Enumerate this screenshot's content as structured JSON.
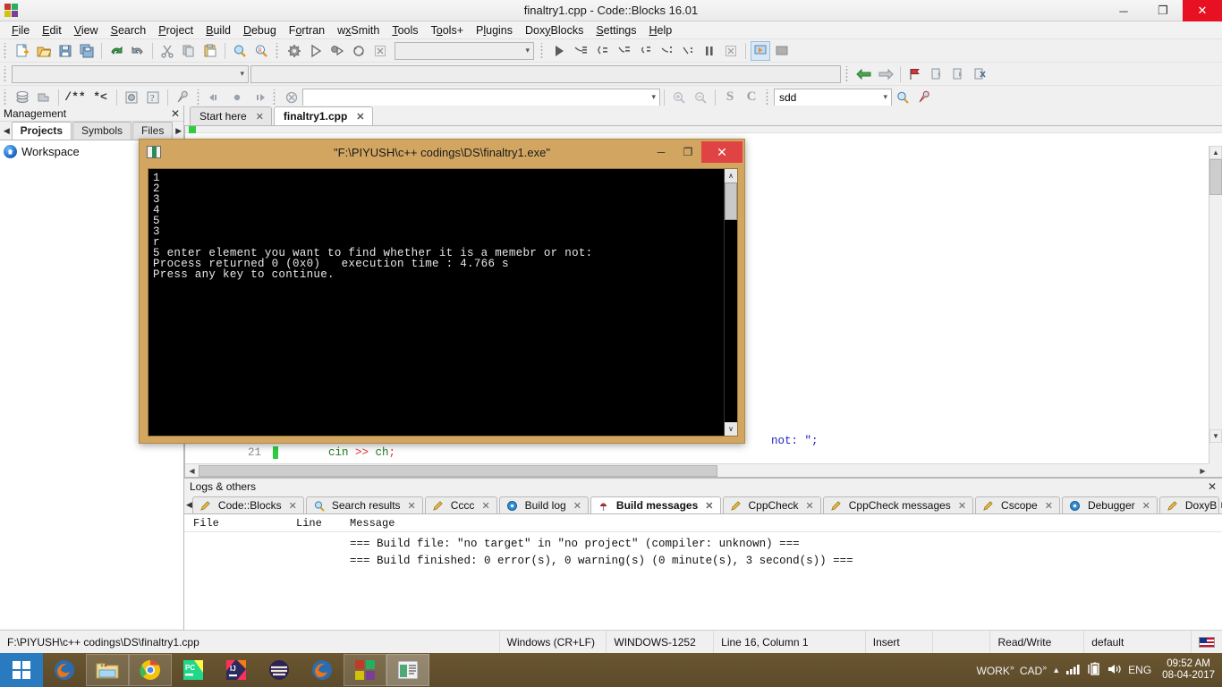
{
  "window": {
    "title": "finaltry1.cpp - Code::Blocks 16.01",
    "minimize": "─",
    "maximize": "❐",
    "close": "✕"
  },
  "menubar": {
    "items": [
      {
        "label": "File",
        "mnemonic": "F"
      },
      {
        "label": "Edit",
        "mnemonic": "E"
      },
      {
        "label": "View",
        "mnemonic": "V"
      },
      {
        "label": "Search",
        "mnemonic": "S"
      },
      {
        "label": "Project",
        "mnemonic": "P"
      },
      {
        "label": "Build",
        "mnemonic": "B"
      },
      {
        "label": "Debug",
        "mnemonic": "D"
      },
      {
        "label": "Fortran",
        "mnemonic": "o"
      },
      {
        "label": "wxSmith",
        "mnemonic": "x"
      },
      {
        "label": "Tools",
        "mnemonic": "T"
      },
      {
        "label": "Tools+",
        "mnemonic": "o"
      },
      {
        "label": "Plugins",
        "mnemonic": "l"
      },
      {
        "label": "DoxyBlocks",
        "mnemonic": "y"
      },
      {
        "label": "Settings",
        "mnemonic": "S"
      },
      {
        "label": "Help",
        "mnemonic": "H"
      }
    ]
  },
  "toolbars": {
    "build_target_value": "",
    "build_target_placeholder": "",
    "symbol_combo_value": "",
    "search_value": "sdd",
    "search_placeholder": ""
  },
  "management": {
    "title": "Management",
    "close_label": "✕",
    "prev_label": "◀",
    "next_label": "▶",
    "tabs": [
      {
        "label": "Projects",
        "active": true
      },
      {
        "label": "Symbols",
        "active": false
      },
      {
        "label": "Files",
        "active": false
      }
    ],
    "tree_root": "Workspace"
  },
  "editor": {
    "tabs": [
      {
        "label": "Start here",
        "active": false,
        "close": "✕"
      },
      {
        "label": "finaltry1.cpp",
        "active": true,
        "close": "✕"
      }
    ],
    "visible_code": [
      {
        "line_number": "21",
        "text": "cin >> ch;"
      }
    ],
    "visible_fragment": "not: \";"
  },
  "console": {
    "title": "\"F:\\PIYUSH\\c++ codings\\DS\\finaltry1.exe\"",
    "minimize": "─",
    "maximize": "❐",
    "close": "✕",
    "output": "1\n2\n3\n4\n5\n3\nr\n5 enter element you want to find whether it is a memebr or not:\nProcess returned 0 (0x0)   execution time : 4.766 s\nPress any key to continue.",
    "scroll_up": "∧",
    "scroll_down": "∨"
  },
  "logs": {
    "title": "Logs & others",
    "close_label": "✕",
    "prev_label": "◀",
    "next_label": "▶",
    "tabs": [
      {
        "label": "Code::Blocks",
        "active": false,
        "icon": "pencil-icon",
        "close": "✕"
      },
      {
        "label": "Search results",
        "active": false,
        "icon": "magnifier-icon",
        "close": "✕"
      },
      {
        "label": "Cccc",
        "active": false,
        "icon": "pencil-icon",
        "close": "✕"
      },
      {
        "label": "Build log",
        "active": false,
        "icon": "gear-blue-icon",
        "close": "✕"
      },
      {
        "label": "Build messages",
        "active": true,
        "icon": "pin-icon",
        "close": "✕"
      },
      {
        "label": "CppCheck",
        "active": false,
        "icon": "pencil-icon",
        "close": "✕"
      },
      {
        "label": "CppCheck messages",
        "active": false,
        "icon": "pencil-icon",
        "close": "✕"
      },
      {
        "label": "Cscope",
        "active": false,
        "icon": "pencil-icon",
        "close": "✕"
      },
      {
        "label": "Debugger",
        "active": false,
        "icon": "gear-blue-icon",
        "close": "✕"
      },
      {
        "label": "DoxyB",
        "active": false,
        "icon": "pencil-icon",
        "close": ""
      }
    ],
    "columns": [
      "File",
      "Line",
      "Message"
    ],
    "rows": [
      {
        "file": "",
        "line": "",
        "message": "=== Build file: \"no target\" in \"no project\" (compiler: unknown) ==="
      },
      {
        "file": "",
        "line": "",
        "message": "=== Build finished: 0 error(s), 0 warning(s) (0 minute(s), 3 second(s)) ==="
      }
    ]
  },
  "statusbar": {
    "path": "F:\\PIYUSH\\c++ codings\\DS\\finaltry1.cpp",
    "eol": "Windows (CR+LF)",
    "encoding": "WINDOWS-1252",
    "caret": "Line 16, Column 1",
    "insert_mode": "Insert",
    "blank": "",
    "access": "Read/Write",
    "profile": "default"
  },
  "taskbar": {
    "start_label": "start-button",
    "items": [
      {
        "name": "firefox",
        "pinned": true
      },
      {
        "name": "file-explorer",
        "pinned": true
      },
      {
        "name": "chrome",
        "pinned": true
      },
      {
        "name": "pycharm",
        "pinned": true
      },
      {
        "name": "intellij-idea",
        "pinned": true
      },
      {
        "name": "eclipse",
        "running": true
      },
      {
        "name": "firefox-window",
        "running": true
      },
      {
        "name": "codeblocks-window",
        "running": true
      },
      {
        "name": "console-window",
        "running": true,
        "active": true
      }
    ],
    "tray": {
      "work_label": "WORK",
      "work_chevron": "»",
      "cad_label": "CAD",
      "cad_chevron": "»",
      "show_hidden": "▲",
      "network_icon": "signal-bars-icon",
      "battery_icon": "battery-icon",
      "volume_icon": "speaker-icon",
      "language": "ENG",
      "time": "09:52 AM",
      "date": "08-04-2017"
    }
  },
  "colors": {
    "console_frame": "#d2a661",
    "close_red": "#e81123",
    "taskbar": "#5b4a2a",
    "start_blue": "#2a7ac0"
  }
}
